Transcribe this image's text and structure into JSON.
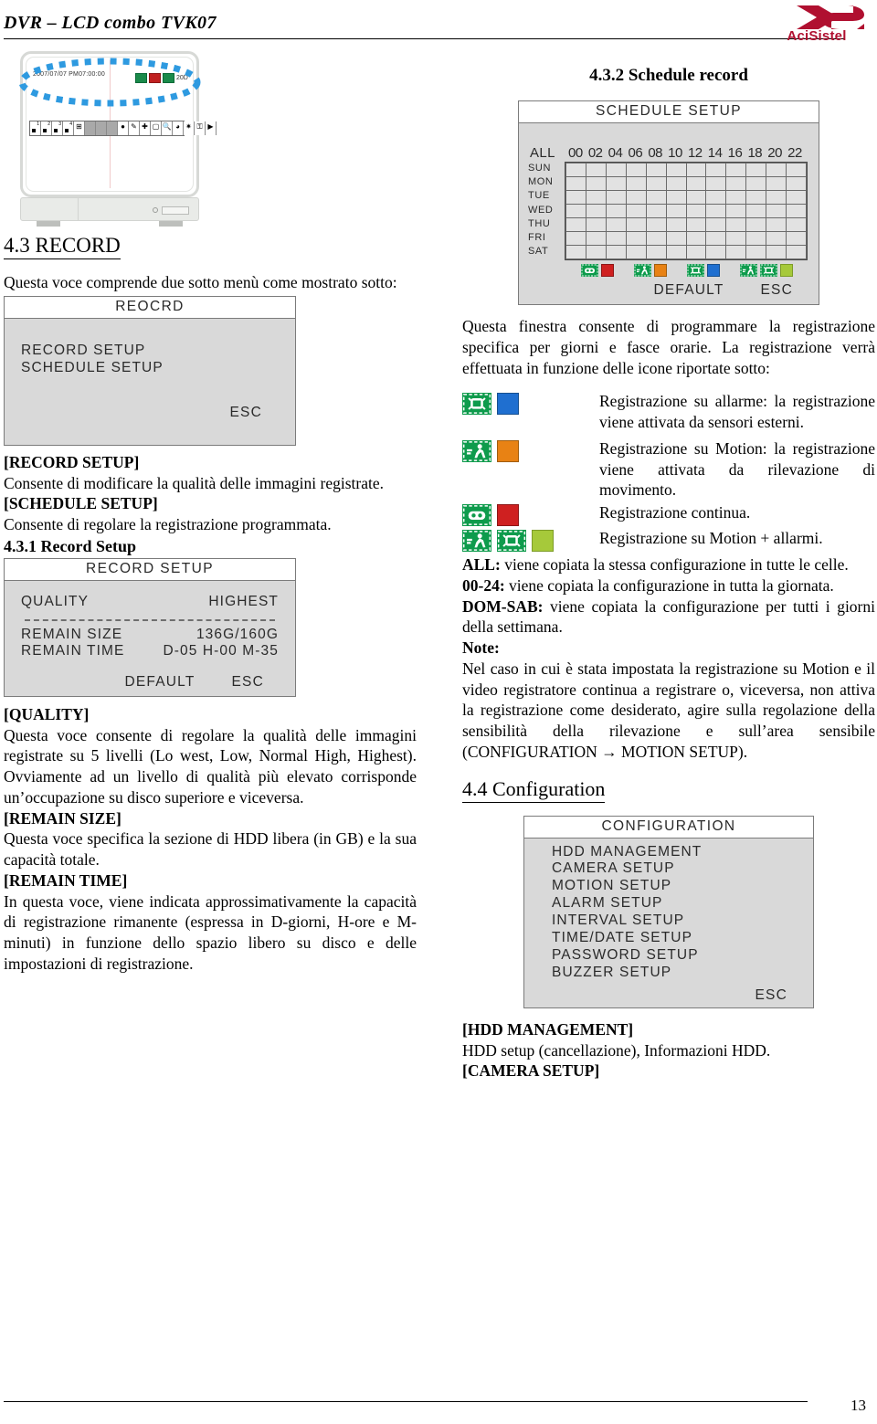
{
  "header": {
    "title": "DVR – LCD  combo TVK07",
    "logo_text": "AciSistel",
    "logo_color": "#b01030"
  },
  "device": {
    "osd_timestamp": "2007/07/07   PM07:00:00",
    "osd_channel_label": "20D",
    "toolbar_numbers": [
      "1",
      "2",
      "3",
      "4"
    ]
  },
  "left_column": {
    "heading": "4.3 RECORD",
    "intro": "Questa voce comprende due sotto menù come mostrato sotto:",
    "record_menu": {
      "title": "REOCRD",
      "items": [
        "RECORD SETUP",
        "SCHEDULE SETUP"
      ],
      "esc": "ESC"
    },
    "record_setup_label": "[RECORD SETUP]",
    "record_setup_text": "Consente di modificare la qualità delle immagini registrate.",
    "schedule_setup_label": "[SCHEDULE SETUP]",
    "schedule_setup_text": "Consente di regolare la registrazione programmata.",
    "subheading": "4.3.1 Record Setup",
    "record_setup_panel": {
      "title": "RECORD SETUP",
      "quality_label": "QUALITY",
      "quality_value": "HIGHEST",
      "remain_size_label": "REMAIN SIZE",
      "remain_size_value": "136G/160G",
      "remain_time_label": "REMAIN TIME",
      "remain_time_value": "D-05 H-00 M-35",
      "default": "DEFAULT",
      "esc": "ESC"
    },
    "quality_label": "[QUALITY]",
    "quality_text": "Questa voce consente di regolare la qualità delle immagini registrate su 5 livelli (Lo west, Low, Normal High, Highest). Ovviamente ad un livello di qualità più elevato corrisponde un’occupazione su disco superiore e viceversa.",
    "remain_size_label": "[REMAIN SIZE]",
    "remain_size_text": "Questa voce specifica la sezione di HDD libera (in GB) e la sua capacità totale.",
    "remain_time_label": "[REMAIN TIME]",
    "remain_time_text": "In questa voce, viene indicata approssimativamente la capacità di registrazione rimanente (espressa in D-giorni, H-ore e M-minuti) in funzione dello spazio libero su disco e delle impostazioni di registrazione."
  },
  "right_column": {
    "subheading": "4.3.2 Schedule record",
    "schedule_panel": {
      "title": "SCHEDULE SETUP",
      "all_label": "ALL",
      "hours": [
        "00",
        "02",
        "04",
        "06",
        "08",
        "10",
        "12",
        "14",
        "16",
        "18",
        "20",
        "22"
      ],
      "days": [
        "SUN",
        "MON",
        "TUE",
        "WED",
        "THU",
        "FRI",
        "SAT"
      ],
      "default": "DEFAULT",
      "esc": "ESC",
      "legend": [
        {
          "icon": "tape-icon",
          "color": "#cf2020"
        },
        {
          "icon": "motion-icon",
          "color": "#e88214"
        },
        {
          "icon": "alarm-icon",
          "color": "#1f6fd0"
        },
        {
          "icon": "motion-alarm-icon",
          "color": "#a6c93a"
        }
      ]
    },
    "intro": "Questa finestra consente di programmare la registrazione specifica per giorni e fasce orarie. La registrazione verrà effettuata in funzione delle icone riportate sotto:",
    "icon_legend": [
      {
        "icons": [
          "alarm-icon"
        ],
        "swatch": "#1f6fd0",
        "text": "Registrazione su allarme: la registrazione viene attivata da sensori esterni."
      },
      {
        "icons": [
          "motion-icon"
        ],
        "swatch": "#e88214",
        "text": "Registrazione su Motion: la registrazione viene attivata da rilevazione di movimento."
      },
      {
        "icons": [
          "tape-icon"
        ],
        "swatch": "#cf2020",
        "text": "Registrazione continua."
      },
      {
        "icons": [
          "motion-icon",
          "alarm-icon"
        ],
        "swatch": "#a6c93a",
        "text": "Registrazione su Motion + allarmi."
      }
    ],
    "all_label": "ALL:",
    "all_text": " viene copiata la stessa configurazione in tutte le celle.",
    "hours_label": "00-24:",
    "hours_text": " viene copiata la configurazione in tutta la giornata.",
    "domsab_label": "DOM-SAB:",
    "domsab_text": " viene copiata la configurazione per tutti i giorni della settimana.",
    "note_label": "Note:",
    "note_text": "Nel caso in cui è stata impostata la registrazione su Motion e il video registratore continua a registrare o, viceversa, non attiva la registrazione come desiderato, agire sulla regolazione della sensibilità della rilevazione e sull’area sensibile (CONFIGURATION → MOTION SETUP).",
    "config_heading": "4.4 Configuration",
    "config_panel": {
      "title": "CONFIGURATION",
      "items": [
        "HDD MANAGEMENT",
        "CAMERA SETUP",
        "MOTION SETUP",
        "ALARM SETUP",
        "INTERVAL SETUP",
        "TIME/DATE SETUP",
        "PASSWORD SETUP",
        "BUZZER SETUP"
      ],
      "esc": "ESC"
    },
    "hdd_label": "[HDD MANAGEMENT]",
    "hdd_text": "HDD setup (cancellazione), Informazioni HDD.",
    "camera_label": "[CAMERA SETUP]"
  },
  "footer": {
    "page_number": "13"
  }
}
